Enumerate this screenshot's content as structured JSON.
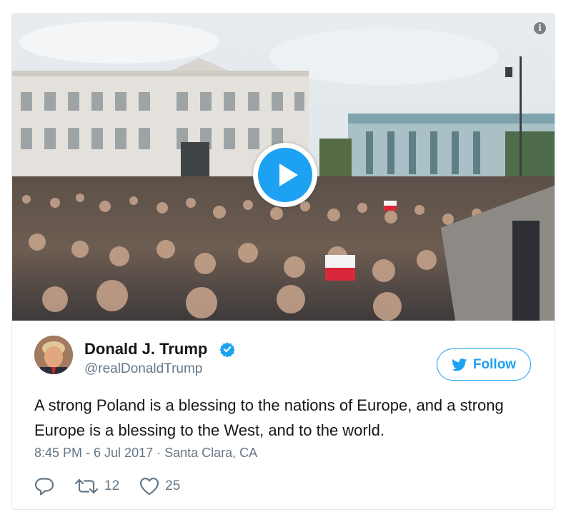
{
  "tweet": {
    "display_name": "Donald J. Trump",
    "handle": "@realDonaldTrump",
    "text": "A strong Poland is a blessing to the nations of Europe, and a strong Europe is a blessing to the West, and to the world.",
    "timestamp": "8:45 PM - 6 Jul 2017 · Santa Clara, CA",
    "follow_label": "Follow",
    "retweet_count": "12",
    "like_count": "25",
    "verified": true
  },
  "media": {
    "type": "video",
    "info_glyph": "i"
  },
  "icons": {
    "twitter_bird": "twitter-bird-icon",
    "verified": "verified-badge-icon",
    "reply": "reply-icon",
    "retweet": "retweet-icon",
    "like": "heart-icon",
    "play": "play-icon",
    "info": "info-icon"
  },
  "colors": {
    "accent": "#1da1f2",
    "text": "#14171a",
    "secondary": "#657786",
    "border": "#e1e8ed"
  }
}
